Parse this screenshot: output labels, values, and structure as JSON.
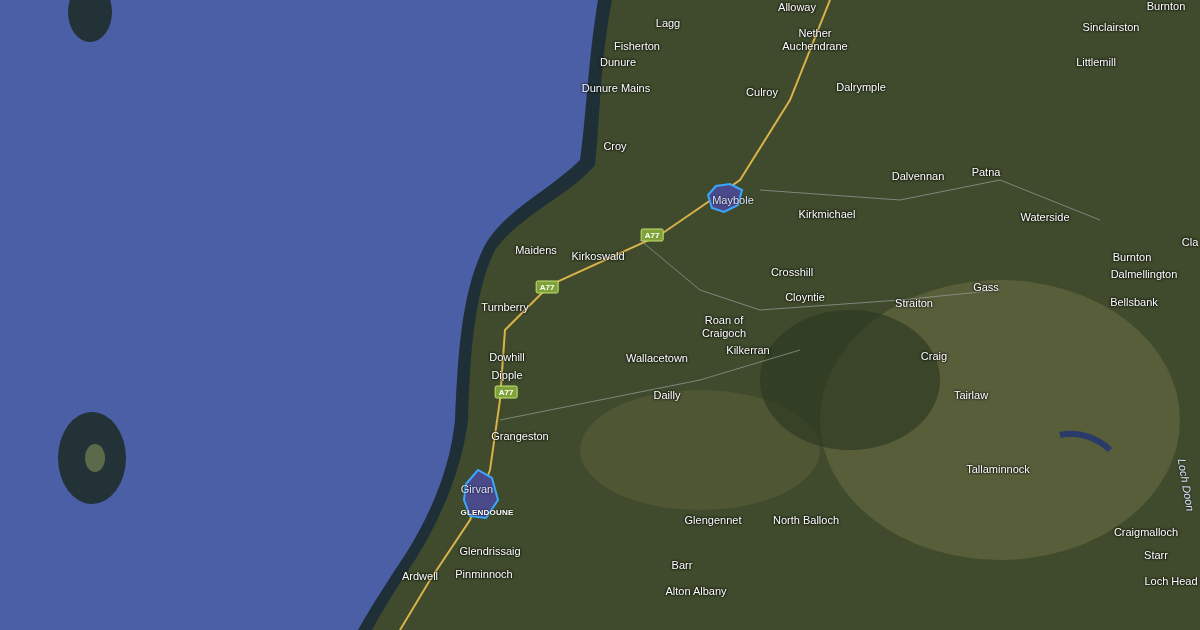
{
  "map": {
    "labels": [
      {
        "name": "Alloway",
        "kind": "place"
      },
      {
        "name": "Burnton",
        "kind": "place"
      },
      {
        "name": "Lagg",
        "kind": "place"
      },
      {
        "name": "Nether\nAuchendrane",
        "kind": "place"
      },
      {
        "name": "Sinclairston",
        "kind": "place"
      },
      {
        "name": "Fisherton",
        "kind": "place"
      },
      {
        "name": "Dunure",
        "kind": "place"
      },
      {
        "name": "Littlemill",
        "kind": "place"
      },
      {
        "name": "Dunure Mains",
        "kind": "place"
      },
      {
        "name": "Culroy",
        "kind": "place"
      },
      {
        "name": "Dalrymple",
        "kind": "place"
      },
      {
        "name": "Croy",
        "kind": "place"
      },
      {
        "name": "Dalvennan",
        "kind": "place"
      },
      {
        "name": "Patna",
        "kind": "place"
      },
      {
        "name": "Maybole",
        "kind": "area"
      },
      {
        "name": "Kirkmichael",
        "kind": "place"
      },
      {
        "name": "Waterside",
        "kind": "place"
      },
      {
        "name": "Cla",
        "kind": "place"
      },
      {
        "name": "Maidens",
        "kind": "place"
      },
      {
        "name": "Kirkoswald",
        "kind": "place"
      },
      {
        "name": "Burnton",
        "kind": "place"
      },
      {
        "name": "Crosshill",
        "kind": "place"
      },
      {
        "name": "Dalmellington",
        "kind": "place"
      },
      {
        "name": "Gass",
        "kind": "place"
      },
      {
        "name": "Cloyntie",
        "kind": "place"
      },
      {
        "name": "Straiton",
        "kind": "place"
      },
      {
        "name": "Bellsbank",
        "kind": "place"
      },
      {
        "name": "Turnberry",
        "kind": "place"
      },
      {
        "name": "Roan of\nCraigoch",
        "kind": "place"
      },
      {
        "name": "Kilkerran",
        "kind": "place"
      },
      {
        "name": "Dowhill",
        "kind": "place"
      },
      {
        "name": "Wallacetown",
        "kind": "place"
      },
      {
        "name": "Craig",
        "kind": "place"
      },
      {
        "name": "Dipple",
        "kind": "place"
      },
      {
        "name": "Dailly",
        "kind": "place"
      },
      {
        "name": "Tairlaw",
        "kind": "place"
      },
      {
        "name": "Grangeston",
        "kind": "place"
      },
      {
        "name": "Tallaminnock",
        "kind": "place"
      },
      {
        "name": "Loch Doon",
        "kind": "water"
      },
      {
        "name": "Girvan",
        "kind": "area"
      },
      {
        "name": "GLENDOUNE",
        "kind": "district"
      },
      {
        "name": "Glengennet",
        "kind": "place"
      },
      {
        "name": "North Balloch",
        "kind": "place"
      },
      {
        "name": "Craigmalloch",
        "kind": "place"
      },
      {
        "name": "Glendrissaig",
        "kind": "place"
      },
      {
        "name": "Starr",
        "kind": "place"
      },
      {
        "name": "Barr",
        "kind": "place"
      },
      {
        "name": "Ardwell",
        "kind": "place"
      },
      {
        "name": "Pinminnoch",
        "kind": "place"
      },
      {
        "name": "Loch Head",
        "kind": "place"
      },
      {
        "name": "Alton Albany",
        "kind": "place"
      }
    ],
    "road_shields": [
      {
        "label": "A77"
      },
      {
        "label": "A77"
      },
      {
        "label": "A77"
      }
    ]
  }
}
